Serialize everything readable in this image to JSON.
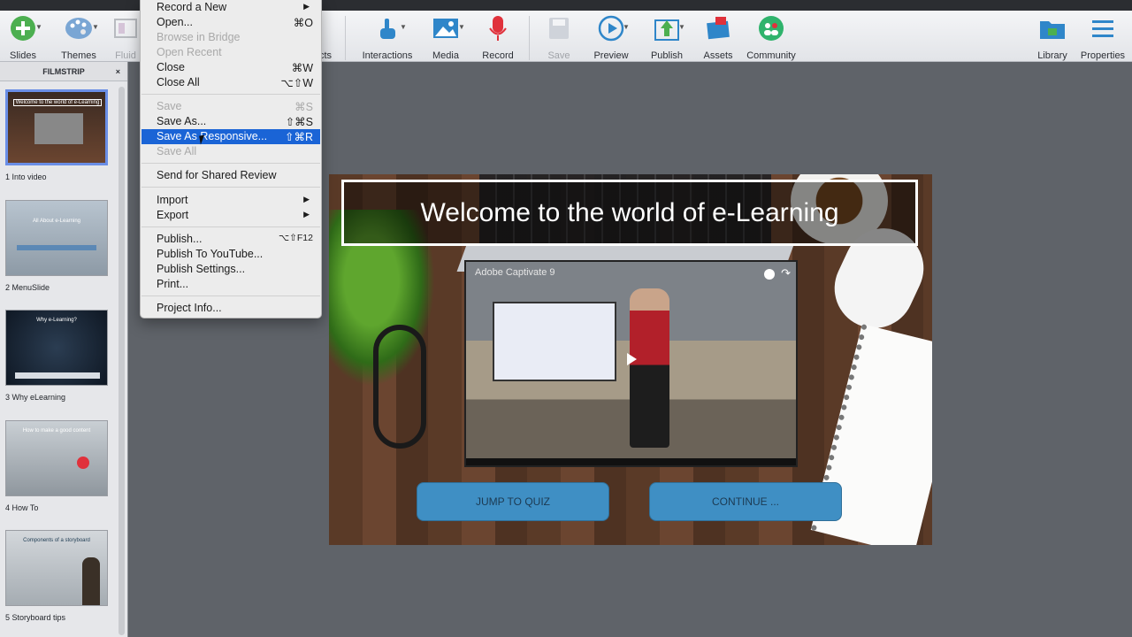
{
  "toolbar": {
    "items": [
      {
        "label": "Slides",
        "icon": "plus-circle-icon"
      },
      {
        "label": "Themes",
        "icon": "palette-icon"
      },
      {
        "label": "Fluid",
        "icon": "fluid-box-icon"
      },
      {
        "label": "cts",
        "icon": "objects-icon"
      },
      {
        "label": "Interactions",
        "icon": "hand-pointer-icon"
      },
      {
        "label": "Media",
        "icon": "image-icon"
      },
      {
        "label": "Record",
        "icon": "microphone-icon"
      },
      {
        "label": "Save",
        "icon": "save-icon"
      },
      {
        "label": "Preview",
        "icon": "play-circle-icon"
      },
      {
        "label": "Publish",
        "icon": "publish-icon"
      },
      {
        "label": "Assets",
        "icon": "assets-icon"
      },
      {
        "label": "Community",
        "icon": "community-icon"
      },
      {
        "label": "Library",
        "icon": "library-folder-icon"
      },
      {
        "label": "Properties",
        "icon": "properties-icon"
      }
    ],
    "accent_color": "#2f86c9",
    "record_color": "#e0313b",
    "community_color": "#2fb36c"
  },
  "filmstrip": {
    "header": "FILMSTRIP",
    "close_glyph": "×",
    "slides": [
      {
        "label": "1 Into video",
        "thumb_text": "Welcome to the world of e-Learning"
      },
      {
        "label": "2 MenuSlide",
        "thumb_text": "All About e-Learning"
      },
      {
        "label": "3 Why eLearning",
        "thumb_text": "Why e-Learning?"
      },
      {
        "label": "4 How To",
        "thumb_text": "How to make a good content"
      },
      {
        "label": "5 Storyboard tips",
        "thumb_text": "Components of a storyboard"
      }
    ]
  },
  "file_menu": {
    "items": [
      {
        "label": "Record a New",
        "shortcut": "",
        "submenu": true
      },
      {
        "label": "Open...",
        "shortcut": "⌘O"
      },
      {
        "label": "Browse in Bridge",
        "shortcut": ""
      },
      {
        "label": "Open Recent",
        "shortcut": ""
      },
      {
        "label": "Close",
        "shortcut": "⌘W"
      },
      {
        "label": "Close All",
        "shortcut": "⌥⇧W"
      },
      {
        "label": "Save",
        "shortcut": "⌘S"
      },
      {
        "label": "Save As...",
        "shortcut": "⇧⌘S"
      },
      {
        "label": "Save As Responsive...",
        "shortcut": "⇧⌘R"
      },
      {
        "label": "Save All",
        "shortcut": ""
      },
      {
        "label": "Send for Shared Review",
        "shortcut": ""
      },
      {
        "label": "Import",
        "shortcut": "",
        "submenu": true
      },
      {
        "label": "Export",
        "shortcut": "",
        "submenu": true
      },
      {
        "label": "Publish...",
        "shortcut": "⌥⇧F12"
      },
      {
        "label": "Publish To YouTube...",
        "shortcut": ""
      },
      {
        "label": "Publish Settings...",
        "shortcut": ""
      },
      {
        "label": "Print...",
        "shortcut": ""
      },
      {
        "label": "Project Info...",
        "shortcut": ""
      }
    ],
    "submenu_glyph": "▶",
    "highlight_color": "#1a64d6"
  },
  "stage": {
    "title": "Welcome to the world of e-Learning",
    "video_title": "Adobe Captivate 9",
    "share_glyph": "↷",
    "buttons": {
      "quiz": "JUMP TO QUIZ",
      "continue": "CONTINUE ..."
    }
  }
}
